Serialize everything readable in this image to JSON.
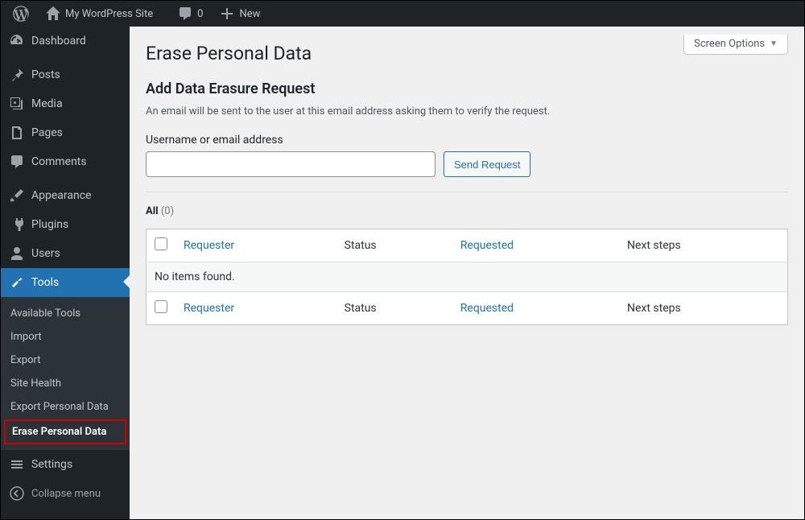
{
  "toolbar": {
    "site_name": "My WordPress Site",
    "comments_count": "0",
    "new_label": "New"
  },
  "sidebar": {
    "items": [
      {
        "label": "Dashboard"
      },
      {
        "label": "Posts"
      },
      {
        "label": "Media"
      },
      {
        "label": "Pages"
      },
      {
        "label": "Comments"
      },
      {
        "label": "Appearance"
      },
      {
        "label": "Plugins"
      },
      {
        "label": "Users"
      },
      {
        "label": "Tools"
      },
      {
        "label": "Settings"
      }
    ],
    "tools_submenu": [
      {
        "label": "Available Tools"
      },
      {
        "label": "Import"
      },
      {
        "label": "Export"
      },
      {
        "label": "Site Health"
      },
      {
        "label": "Export Personal Data"
      },
      {
        "label": "Erase Personal Data"
      }
    ],
    "collapse_label": "Collapse menu"
  },
  "screen_options_label": "Screen Options",
  "page": {
    "title": "Erase Personal Data",
    "subheading": "Add Data Erasure Request",
    "description": "An email will be sent to the user at this email address asking them to verify the request.",
    "field_label": "Username or email address",
    "send_button": "Send Request",
    "filter": {
      "label": "All",
      "count": "(0)"
    },
    "table": {
      "cols": {
        "requester": "Requester",
        "status": "Status",
        "requested": "Requested",
        "next": "Next steps"
      },
      "empty_msg": "No items found."
    }
  }
}
